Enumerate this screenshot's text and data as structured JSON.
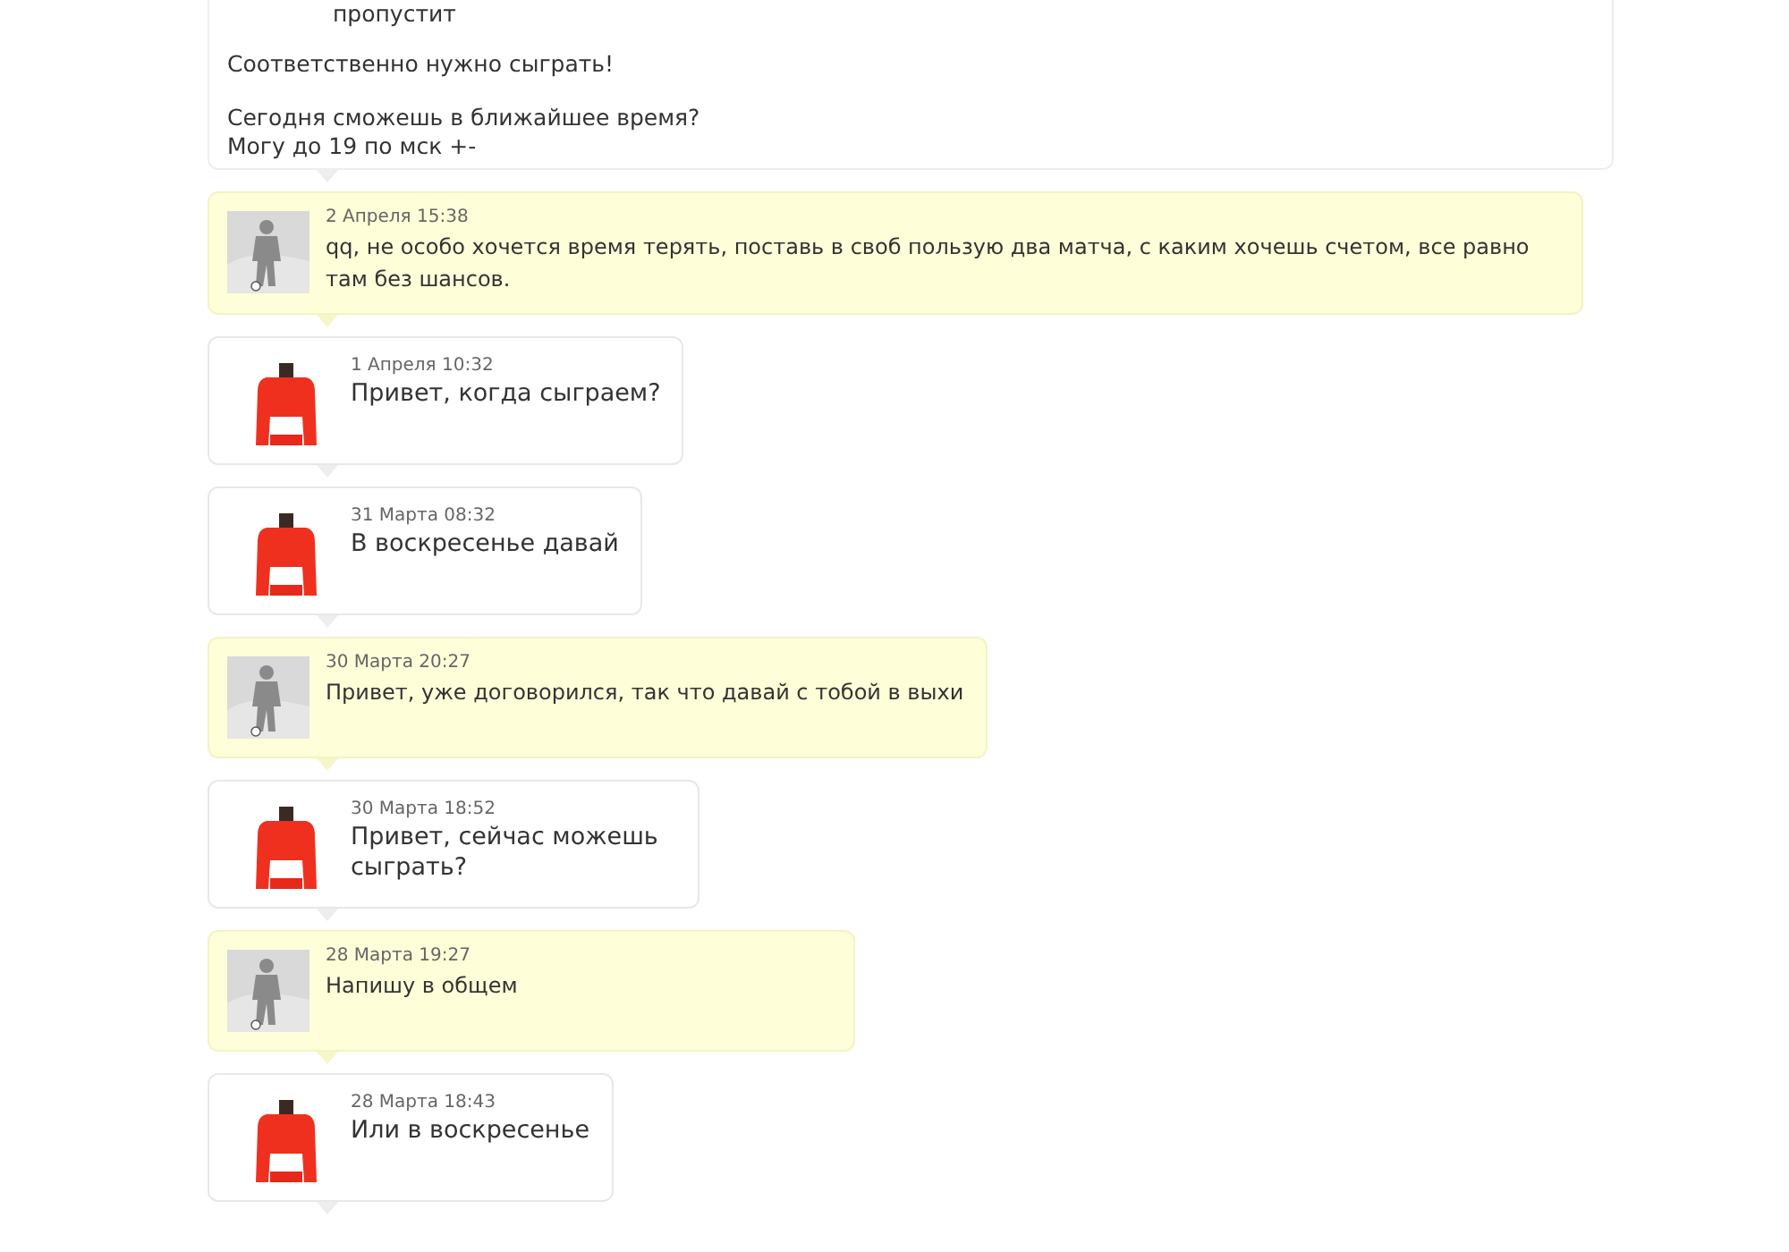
{
  "top_message": {
    "lines": [
      "пропустит"
    ],
    "paragraphs": [
      "Соответственно нужно сыграть!",
      "Сегодня сможешь в ближайшее время?\nМогу до 19 по мск +-"
    ]
  },
  "messages": [
    {
      "kind": "incoming",
      "time": "2 Апреля 15:38",
      "text": "qq, не особо хочется время терять, поставь в своб пользую два матча, с каким хочешь счетом, все равно там без шансов."
    },
    {
      "kind": "outgoing",
      "time": "1 Апреля 10:32",
      "text": "Привет, когда сыграем?"
    },
    {
      "kind": "outgoing",
      "time": "31 Марта 08:32",
      "text": "В воскресенье давай"
    },
    {
      "kind": "incoming",
      "time": "30 Марта 20:27",
      "text": "Привет, уже договорился, так что давай с тобой в выхи"
    },
    {
      "kind": "outgoing",
      "time": "30 Марта 18:52",
      "text": "Привет, сейчас можешь сыграть?"
    },
    {
      "kind": "incoming",
      "time": "28 Марта 19:27",
      "text": "Напишу в общем"
    },
    {
      "kind": "outgoing",
      "time": "28 Марта 18:43",
      "text": "Или в воскресенье"
    }
  ]
}
